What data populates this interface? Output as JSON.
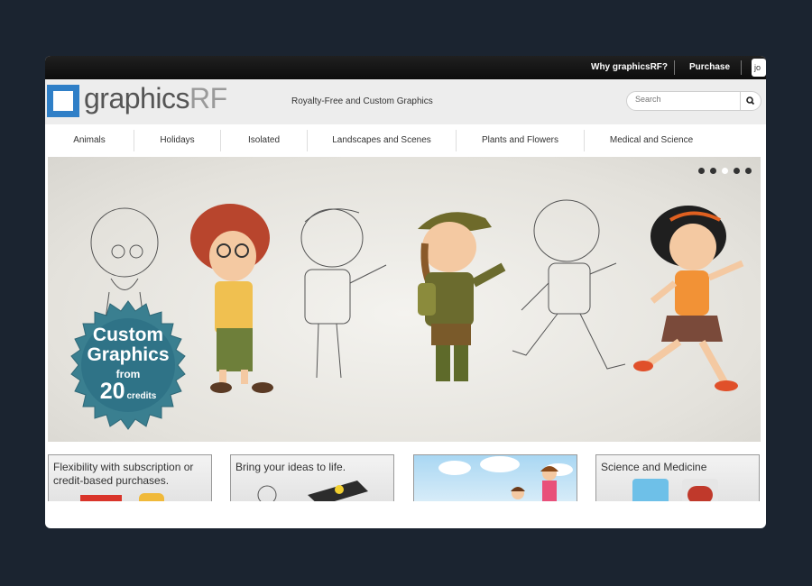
{
  "topbar": {
    "why_label": "Why graphicsRF?",
    "purchase_label": "Purchase",
    "login_label": "jo"
  },
  "header": {
    "logo_main": "graphics",
    "logo_accent": "RF",
    "tagline": "Royalty-Free and Custom Graphics",
    "search_placeholder": "Search",
    "search_icon": "search-icon"
  },
  "nav": {
    "items": [
      {
        "label": "Animals"
      },
      {
        "label": "Holidays"
      },
      {
        "label": "Isolated"
      },
      {
        "label": "Landscapes and Scenes"
      },
      {
        "label": "Plants and Flowers"
      },
      {
        "label": "Medical and Science"
      }
    ]
  },
  "hero": {
    "slide_count": 5,
    "active_slide": 3,
    "badge": {
      "line1": "Custom",
      "line2": "Graphics",
      "line3": "from",
      "amount": "20",
      "unit": "credits"
    }
  },
  "cards": [
    {
      "title": "Flexibility with subscription or credit-based purchases."
    },
    {
      "title": "Bring your ideas to life."
    },
    {
      "title": ""
    },
    {
      "title": "Science and Medicine"
    }
  ],
  "colors": {
    "page_bg": "#1b2430",
    "logo_blue": "#2f7fc7",
    "badge_teal": "#3a7f90",
    "topbar_bg": "#111111"
  }
}
